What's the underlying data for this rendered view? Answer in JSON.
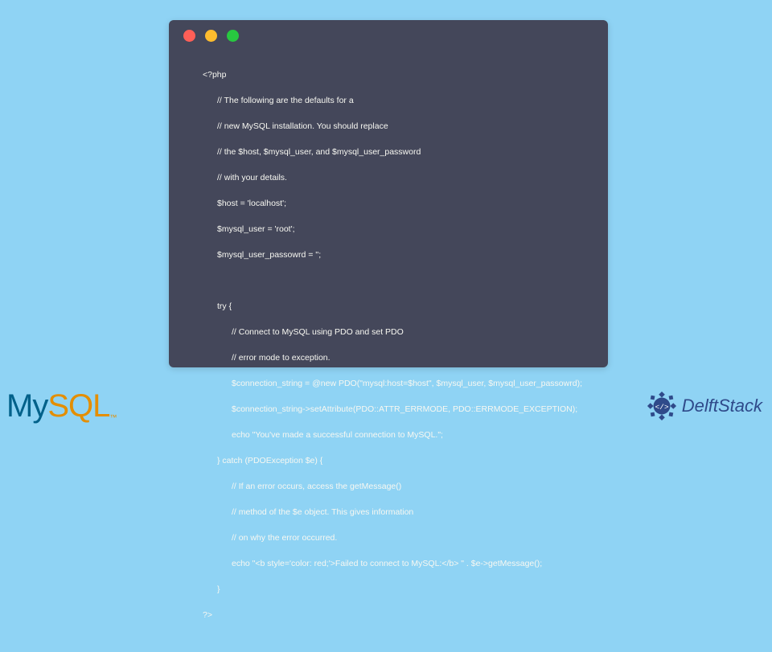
{
  "code": {
    "l1": "<?php",
    "l2": "// The following are the defaults for a",
    "l3": "// new MySQL installation. You should replace",
    "l4": "// the $host, $mysql_user, and $mysql_user_password",
    "l5": "// with your details.",
    "l6": "$host = 'localhost';",
    "l7": "$mysql_user = 'root';",
    "l8": "$mysql_user_passowrd = '';",
    "l9": "try {",
    "l10": "// Connect to MySQL using PDO and set PDO",
    "l11": "// error mode to exception.",
    "l12": "$connection_string = @new PDO(\"mysql:host=$host\", $mysql_user, $mysql_user_passowrd);",
    "l13": "$connection_string->setAttribute(PDO::ATTR_ERRMODE, PDO::ERRMODE_EXCEPTION);",
    "l14": "echo \"You've made a successful connection to MySQL.\";",
    "l15": "} catch (PDOException $e) {",
    "l16": "// If an error occurs, access the getMessage()",
    "l17": "// method of the $e object. This gives information",
    "l18": "// on why the error occurred.",
    "l19": "echo \"<b style='color: red;'>Failed to connect to MySQL:</b> \" . $e->getMessage();",
    "l20": "}",
    "l21": "?>"
  },
  "logos": {
    "mysql_my": "My",
    "mysql_sql": "SQL",
    "mysql_tm": "™",
    "delft": "DelftStack"
  }
}
